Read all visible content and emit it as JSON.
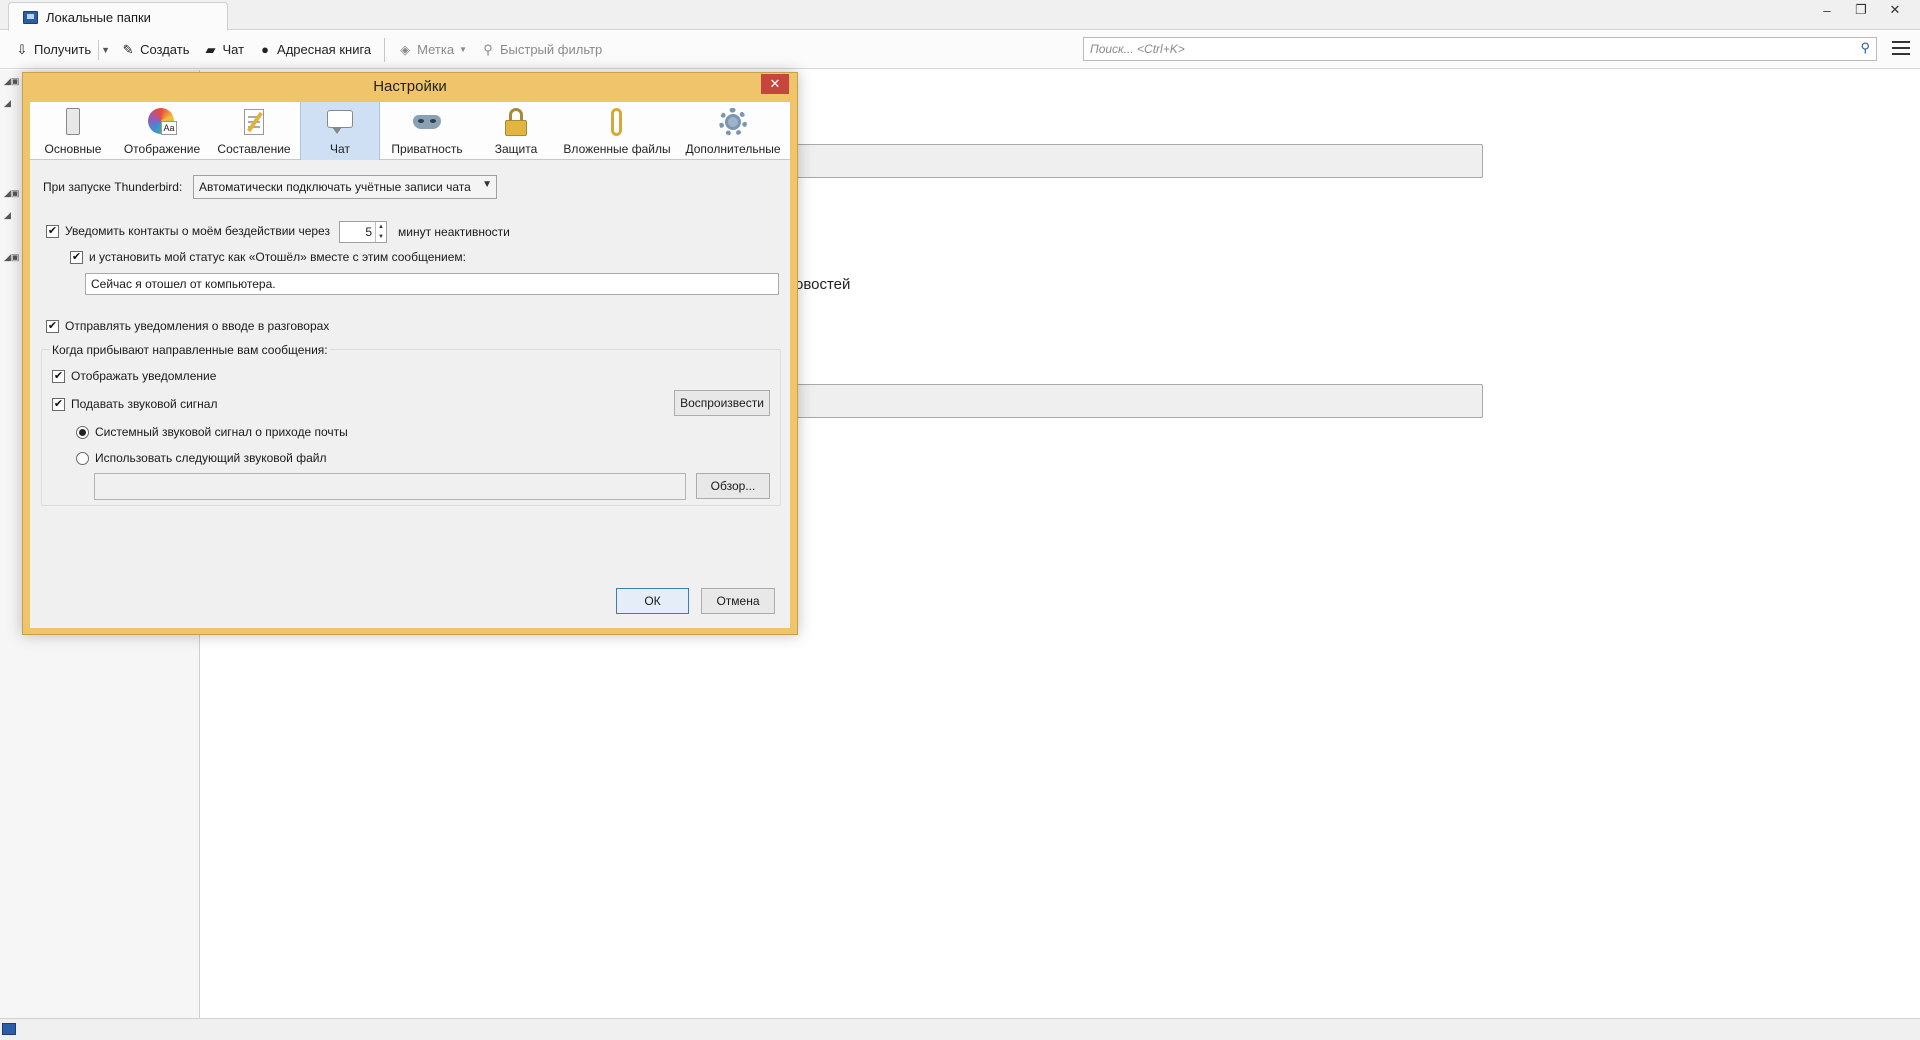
{
  "window": {
    "tab_label": "Локальные папки",
    "minimize": "–",
    "restore": "❐",
    "close": "✕"
  },
  "toolbar": {
    "get_label": "Получить",
    "create_label": "Создать",
    "chat_label": "Чат",
    "addressbook_label": "Адресная книга",
    "tag_label": "Метка",
    "quickfilter_label": "Быстрый фильтр",
    "search_placeholder": "Поиск... <Ctrl+K>"
  },
  "background": {
    "partial_text": "овостей"
  },
  "dialog": {
    "title": "Настройки",
    "close": "✕",
    "panes": [
      {
        "label": "Основные",
        "icon": "general-icon"
      },
      {
        "label": "Отображение",
        "icon": "display-icon"
      },
      {
        "label": "Составление",
        "icon": "composition-icon"
      },
      {
        "label": "Чат",
        "icon": "chat-icon",
        "selected": true
      },
      {
        "label": "Приватность",
        "icon": "privacy-mask-icon"
      },
      {
        "label": "Защита",
        "icon": "security-lock-icon"
      },
      {
        "label": "Вложенные файлы",
        "icon": "attachment-clip-icon"
      },
      {
        "label": "Дополнительные",
        "icon": "advanced-gear-icon"
      }
    ],
    "startup_label": "При запуске Thunderbird:",
    "startup_select": "Автоматически подключать учётные записи чата",
    "idle_checkbox": "Уведомить контакты о моём бездействии через",
    "idle_checked": true,
    "idle_minutes": "5",
    "idle_suffix": "минут неактивности",
    "away_checkbox": "и установить мой статус как «Отошёл» вместе с этим сообщением:",
    "away_checked": true,
    "away_message": "Сейчас я отошел от компьютера.",
    "typing_checkbox": "Отправлять уведомления о вводе в разговорах",
    "typing_checked": true,
    "incoming_group_label": "Когда прибывают направленные вам сообщения:",
    "show_alert_checkbox": "Отображать уведомление",
    "show_alert_checked": true,
    "play_sound_checkbox": "Подавать звуковой сигнал",
    "play_sound_checked": true,
    "play_button": "Воспроизвести",
    "system_sound_radio": "Системный звуковой сигнал о приходе почты",
    "system_sound_selected": true,
    "custom_sound_radio": "Использовать следующий звуковой файл",
    "custom_sound_path": "",
    "browse_button": "Обзор...",
    "ok_button": "ОК",
    "cancel_button": "Отмена"
  }
}
